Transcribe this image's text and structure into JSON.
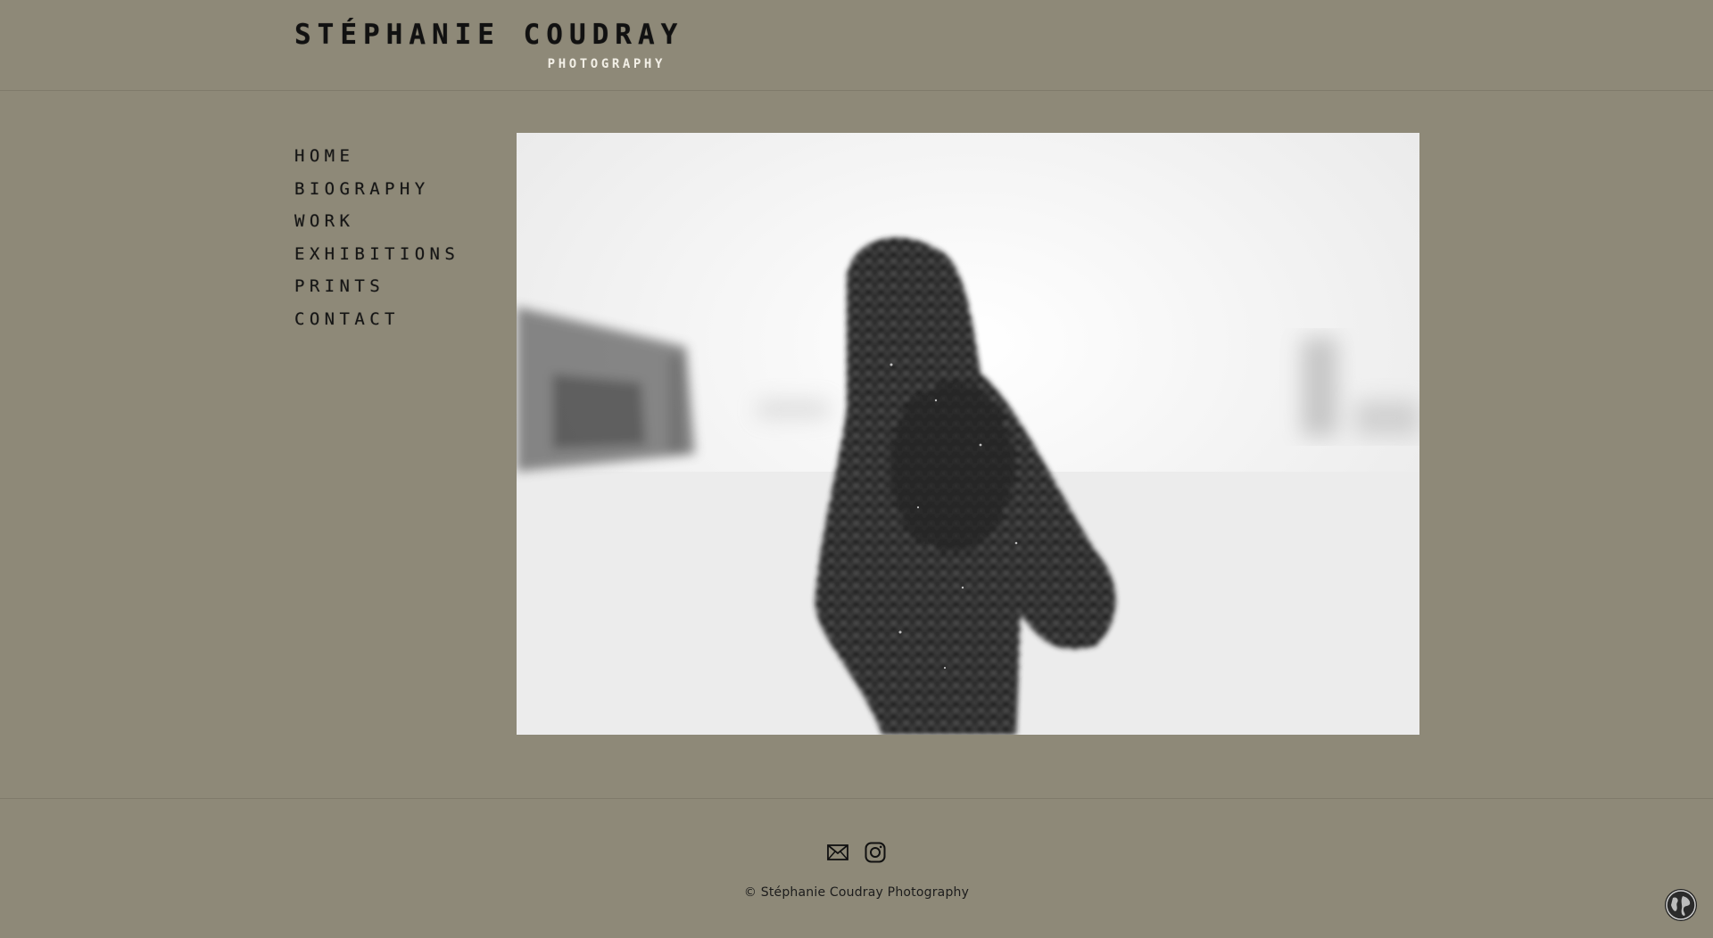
{
  "header": {
    "logo_name": "STÉPHANIE COUDRAY",
    "logo_subtitle": "PHOTOGRAPHY"
  },
  "nav": {
    "items": [
      {
        "label": "HOME"
      },
      {
        "label": "BIOGRAPHY"
      },
      {
        "label": "WORK"
      },
      {
        "label": "EXHIBITIONS"
      },
      {
        "label": "PRINTS"
      },
      {
        "label": "CONTACT"
      }
    ]
  },
  "main": {
    "photo_icon": "photo-hooded-figure-in-snow"
  },
  "footer": {
    "social_icons": [
      "email-icon",
      "instagram-icon"
    ],
    "copyright": "© Stéphanie Coudray Photography"
  },
  "colors": {
    "background": "#8e8978",
    "text": "#111111",
    "subtitle": "#f2efe6"
  },
  "widgets": {
    "language_icon": "globe-icon"
  }
}
